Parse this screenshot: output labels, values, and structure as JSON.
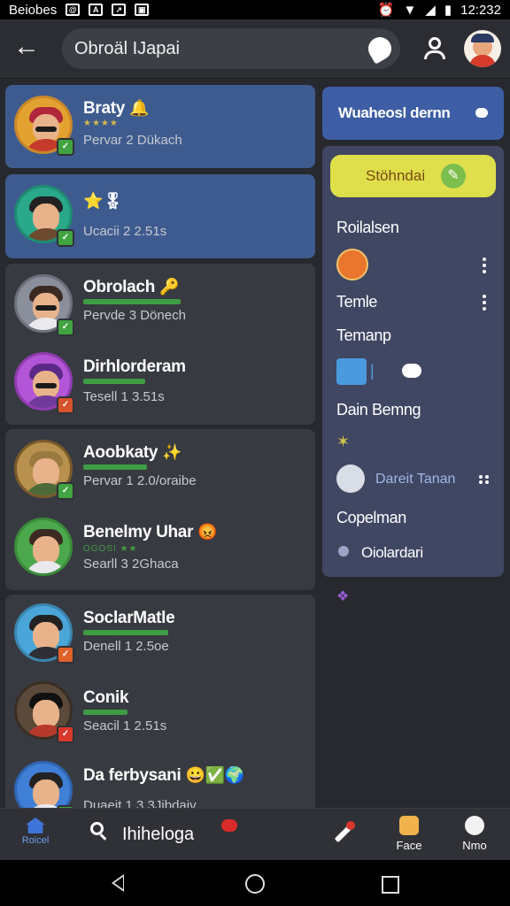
{
  "status_bar": {
    "left_text": "Beiobes",
    "time": "12:232"
  },
  "top_bar": {
    "search_value": "Obroäl IJapai"
  },
  "chats": [
    {
      "name": "Braty",
      "emoji": "🔔",
      "sub": "Pervar 2 Dükach",
      "stars": "★★★★"
    },
    {
      "name": "",
      "emoji": "⭐🎖",
      "sub": "Ucacii 2 2.51s"
    },
    {
      "name": "Obrolach",
      "emoji": "🔑",
      "sub": "Pervde 3 Dönech"
    },
    {
      "name": "Dirhlorderam",
      "emoji": "",
      "sub": "Tesell 1 3.51s"
    },
    {
      "name": "Aoobkaty",
      "emoji": "✨",
      "sub": "Pervar 1 2.0/oraibe"
    },
    {
      "name": "Benelmy Uhar",
      "emoji": "😡",
      "sub": "Searll 3 2Ghaca",
      "stars": "OGOSI ★★"
    },
    {
      "name": "SoclarMatle",
      "emoji": "",
      "sub": "Denell 1 2.5oe"
    },
    {
      "name": "Conik",
      "emoji": "",
      "sub": "Seacil 1 2.51s"
    },
    {
      "name": "Da ferbysani",
      "emoji": "😀✅🌍",
      "sub": "Duaeit 1 3 3Jibdaiv"
    }
  ],
  "right_panel": {
    "header": "Wuaheosl dernn",
    "pill_label": "Stöhndai",
    "items": [
      "Roilalsen",
      "Temle",
      "Temanp",
      "Dain Bemng",
      "Dareit Tanan",
      "Copelman",
      "Oiolardari"
    ]
  },
  "bottom_nav": {
    "home_label": "Roicel",
    "search_label": "Ihiheloga",
    "item_face": "Face",
    "item_nmo": "Nmo"
  },
  "colors": {
    "background": "#27292f",
    "card_active": "#3e5b8f",
    "card_dark": "#383a41",
    "right_panel": "#404763",
    "pill": "#dfdf4b",
    "accent_blue": "#3f74d8"
  }
}
